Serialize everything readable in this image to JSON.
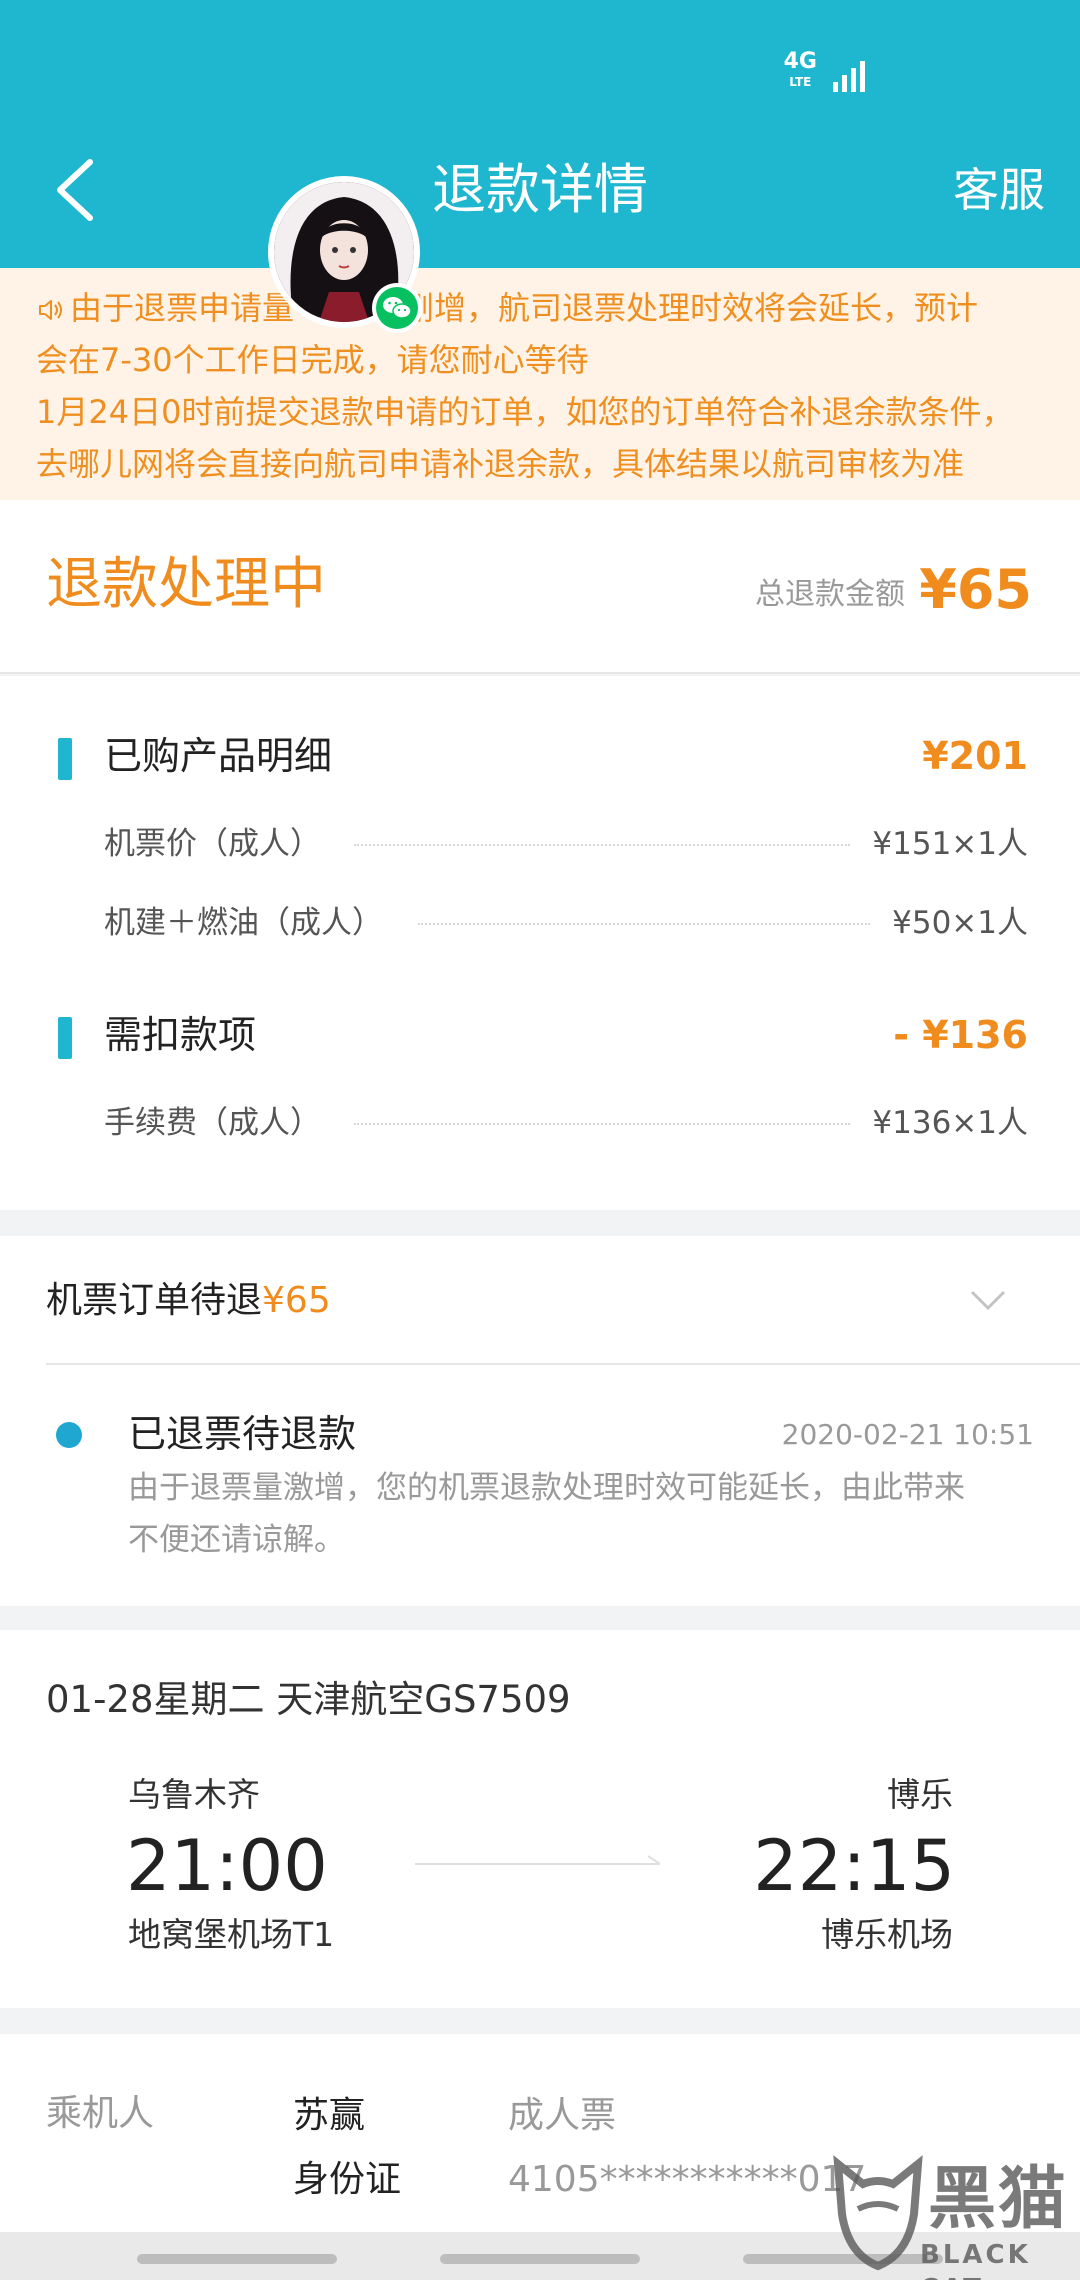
{
  "status_bar": {
    "network": "4G",
    "network_sub": "LTE"
  },
  "header": {
    "title": "退款详情",
    "service_label": "客服"
  },
  "notice": {
    "lines": [
      "由于退票申请量",
      "剧增，航司退票处理时效将会延长，预计",
      "会在7-30个工作日完成，请您耐心等待",
      "1月24日0时前提交退款申请的订单，如您的订单符合补退余款条件，",
      "去哪儿网将会直接向航司申请补退余款，具体结果以航司审核为准"
    ]
  },
  "refund_status": {
    "status": "退款处理中",
    "total_label": "总退款金额",
    "total_amount": "¥65"
  },
  "purchased": {
    "title": "已购产品明细",
    "amount": "¥201",
    "items": [
      {
        "label": "机票价（成人）",
        "value": "¥151×1人"
      },
      {
        "label": "机建＋燃油（成人）",
        "value": "¥50×1人"
      }
    ]
  },
  "deductions": {
    "title": "需扣款项",
    "amount": "- ¥136",
    "items": [
      {
        "label": "手续费（成人）",
        "value": "¥136×1人"
      }
    ]
  },
  "refund_order": {
    "title": "机票订单待退",
    "amount": "¥65",
    "step_title": "已退票待退款",
    "step_time": "2020-02-21 10:51",
    "step_desc_1": "由于退票量激增，您的机票退款处理时效可能延长，由此带来",
    "step_desc_2": "不便还请谅解。"
  },
  "flight": {
    "header": "01-28星期二  天津航空GS7509",
    "dep_city": "乌鲁木齐",
    "dep_time": "21:00",
    "dep_airport": "地窝堡机场T1",
    "arr_city": "博乐",
    "arr_time": "22:15",
    "arr_airport": "博乐机场"
  },
  "passenger": {
    "label": "乘机人",
    "name": "苏赢",
    "ticket_type": "成人票",
    "id_label": "身份证",
    "id_number": "4105***********017"
  },
  "watermark": {
    "cn": "黑猫",
    "en": "BLACK CAT"
  },
  "colors": {
    "brand": "#1fb6cf",
    "accent": "#f08c1e",
    "notice_bg": "#fff3e8"
  }
}
